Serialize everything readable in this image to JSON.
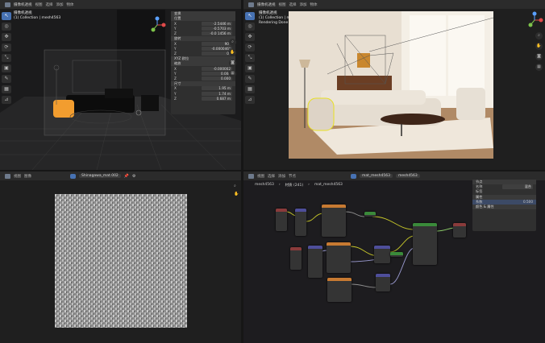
{
  "viewport_tl": {
    "editor_label": "摄像机透视",
    "info_line_1": "摄像机透视",
    "info_line_2": "(1) Collection | mesh4563",
    "menus": [
      "视图",
      "选择",
      "添加",
      "物体"
    ],
    "tools": [
      "↖",
      "◎",
      "✥",
      "⟳",
      "⤡",
      "▣",
      "✎",
      "▦",
      "⊿"
    ],
    "panel_title": "变换",
    "panel_rows": [
      {
        "label": "位置",
        "value": "",
        "section": true
      },
      {
        "label": "X",
        "value": "-2.5446 m"
      },
      {
        "label": "Y",
        "value": "-0.5703 m"
      },
      {
        "label": "Z",
        "value": "-0.0 1456 m"
      },
      {
        "label": "旋转",
        "value": "",
        "section": true
      },
      {
        "label": "X",
        "value": "90°"
      },
      {
        "label": "Y",
        "value": "-0.000046°"
      },
      {
        "label": "Z",
        "value": "0°"
      },
      {
        "label": "XYZ 欧拉",
        "value": "",
        "section": true
      },
      {
        "label": "缩放",
        "value": "",
        "section": true
      },
      {
        "label": "X",
        "value": "-0.000002"
      },
      {
        "label": "Y",
        "value": "0.004"
      },
      {
        "label": "Z",
        "value": "0.000"
      },
      {
        "label": "尺寸",
        "value": "",
        "section": true
      },
      {
        "label": "X",
        "value": "1.95 m"
      },
      {
        "label": "Y",
        "value": "1.74 m"
      },
      {
        "label": "Z",
        "value": "0.687 m"
      }
    ]
  },
  "viewport_tr": {
    "editor_label": "摄像机透视",
    "info_line_1": "摄像机透视",
    "info_line_2": "(1) Collection | mesh4563",
    "info_line_3": "Rendering Done"
  },
  "image_editor": {
    "menus": [
      "视图",
      "图像"
    ],
    "image_name": "Shinagawa_mat.002"
  },
  "node_editor": {
    "menus": [
      "视图",
      "选择",
      "添加",
      "节点"
    ],
    "object_name": "mesh4563",
    "material_name": "mat_mesh4563",
    "breadcrumb_object": "mesh4563",
    "breadcrumb_mat_slot": "材质 (241)",
    "breadcrumb_material": "mat_mesh4563",
    "panel_title": "节点",
    "panel_name_label": "名称",
    "panel_name_value": "混合",
    "panel_label_label": "标签",
    "panel_label_value": "",
    "panel_section": "属性",
    "panel_highlight_label": "系数",
    "panel_highlight_value": "0.500",
    "panel_footer": "颜色 & 属性"
  },
  "colors": {
    "accent": "#4772b3",
    "header_bg": "#2b2b2b",
    "selection_orange": "#f29d2f"
  }
}
